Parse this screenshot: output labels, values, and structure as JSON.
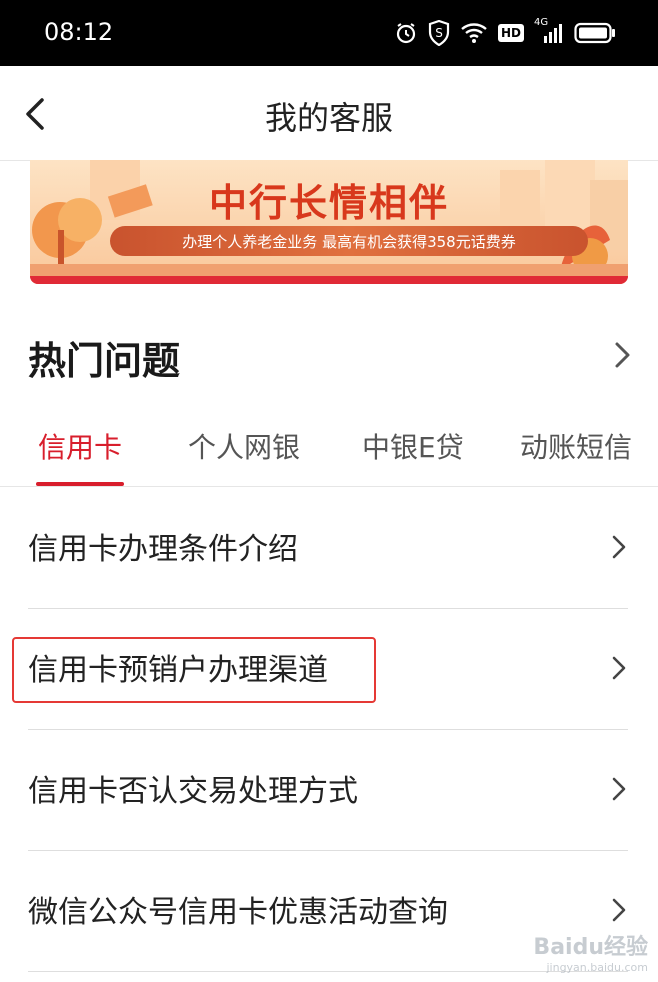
{
  "status": {
    "time": "08:12",
    "icons": [
      "alarm-icon",
      "shield-icon",
      "wifi-icon",
      "hd-icon",
      "signal-icon",
      "battery-icon"
    ],
    "hd": "HD",
    "network": "4G"
  },
  "nav": {
    "title": "我的客服"
  },
  "banner": {
    "title": "中行长情相伴",
    "subtitle": "办理个人养老金业务 最高有机会获得358元话费券"
  },
  "section": {
    "title": "热门问题"
  },
  "tabs": [
    "信用卡",
    "个人网银",
    "中银E贷",
    "动账短信"
  ],
  "questions": [
    "信用卡办理条件介绍",
    "信用卡预销户办理渠道",
    "信用卡否认交易处理方式",
    "微信公众号信用卡优惠活动查询"
  ],
  "watermark": {
    "main": "Baidu经验",
    "sub": "jingyan.baidu.com"
  },
  "colors": {
    "accent": "#d81e2c",
    "highlight": "#e53935"
  }
}
